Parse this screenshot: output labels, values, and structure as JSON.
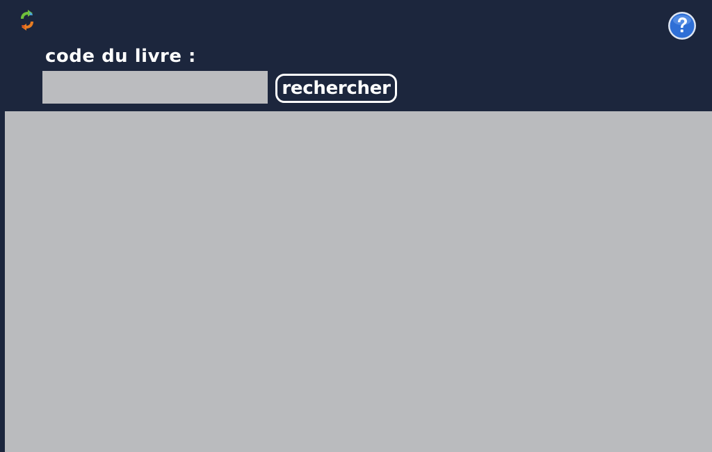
{
  "toolbar": {
    "refresh_icon": "refresh-icon",
    "help_icon": "help-icon"
  },
  "search": {
    "label": "code du livre :",
    "input_value": "",
    "button_label": "rechercher"
  },
  "colors": {
    "background": "#1c263d",
    "panel": "#babbbe",
    "input": "#bbbcbf",
    "text": "#ffffff",
    "help_blue": "#2f6fd6",
    "refresh_green": "#6fbf3a",
    "refresh_orange": "#e77c22"
  }
}
